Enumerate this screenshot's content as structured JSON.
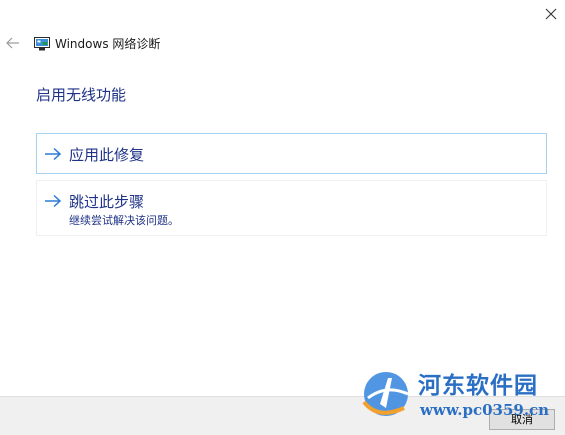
{
  "window": {
    "title": "Windows 网络诊断",
    "close_icon": "close-icon",
    "back_icon": "back-arrow-icon"
  },
  "main": {
    "heading": "启用无线功能",
    "options": [
      {
        "title": "应用此修复",
        "icon": "arrow-right-icon"
      },
      {
        "title": "跳过此步骤",
        "description": "继续尝试解决该问题。",
        "icon": "arrow-right-icon"
      }
    ]
  },
  "footer": {
    "cancel_label": "取消"
  },
  "watermark": {
    "name": "河东软件园",
    "url": "www.pc0359.cn"
  },
  "colors": {
    "accent_text": "#1e3287",
    "arrow": "#2a7ad5",
    "selected_border": "#a6d3f0",
    "footer_bg": "#f0f0f0"
  }
}
